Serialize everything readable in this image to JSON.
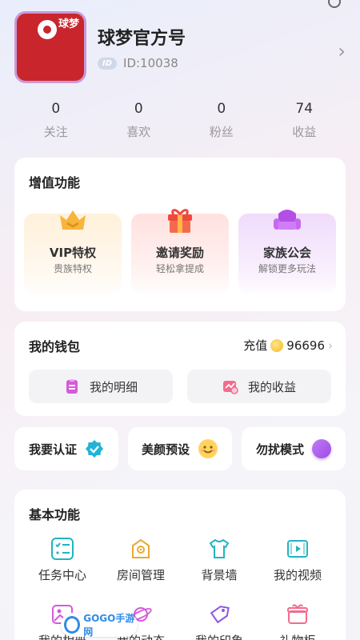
{
  "profile": {
    "avatar_text": "球梦",
    "name": "球梦官方号",
    "id_badge": "ID",
    "id_text": "ID:10038"
  },
  "stats": [
    {
      "value": "0",
      "label": "关注"
    },
    {
      "value": "0",
      "label": "喜欢"
    },
    {
      "value": "0",
      "label": "粉丝"
    },
    {
      "value": "74",
      "label": "收益"
    }
  ],
  "value_added": {
    "title": "增值功能",
    "items": [
      {
        "title": "VIP特权",
        "subtitle": "贵族特权",
        "icon": "crown-icon"
      },
      {
        "title": "邀请奖励",
        "subtitle": "轻松拿提成",
        "icon": "gift-icon"
      },
      {
        "title": "家族公会",
        "subtitle": "解锁更多玩法",
        "icon": "sofa-icon"
      }
    ]
  },
  "wallet": {
    "title": "我的钱包",
    "recharge_label": "充值",
    "coins": "96696",
    "detail_label": "我的明细",
    "income_label": "我的收益"
  },
  "quick": {
    "cert_label": "我要认证",
    "beauty_label": "美颜预设",
    "dnd_label": "勿扰模式"
  },
  "basic": {
    "title": "基本功能",
    "items": [
      {
        "label": "任务中心",
        "icon": "task-list-icon"
      },
      {
        "label": "房间管理",
        "icon": "room-icon"
      },
      {
        "label": "背景墙",
        "icon": "tshirt-icon"
      },
      {
        "label": "我的视频",
        "icon": "video-icon"
      },
      {
        "label": "我的相册",
        "icon": "album-icon"
      },
      {
        "label": "我的动态",
        "icon": "planet-icon"
      },
      {
        "label": "我的印象",
        "icon": "tag-icon"
      },
      {
        "label": "礼物柜",
        "icon": "gift-cabinet-icon"
      }
    ]
  },
  "watermark": {
    "text": "GOGO手游网"
  },
  "colors": {
    "accent": "#b03ee0",
    "teal": "#1fb6c2",
    "red": "#c8262c"
  }
}
